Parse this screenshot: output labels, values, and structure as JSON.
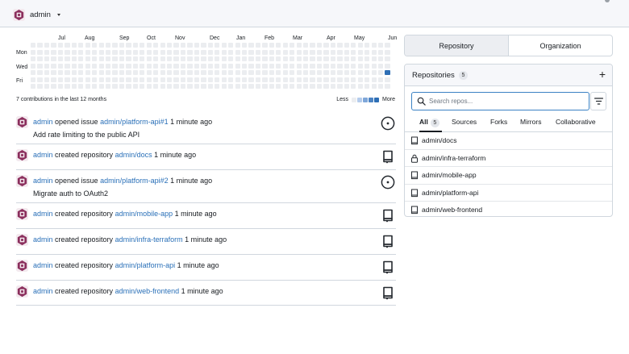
{
  "header": {
    "context_name": "admin"
  },
  "heatmap": {
    "months": [
      "Jul",
      "Aug",
      "Sep",
      "Oct",
      "Nov",
      "Dec",
      "Jan",
      "Feb",
      "Mar",
      "Apr",
      "May",
      "Jun"
    ],
    "day_labels": [
      "Mon",
      "Wed",
      "Fri"
    ],
    "total_text": "7 contributions in the last 12 months",
    "legend_less": "Less",
    "legend_more": "More",
    "level_colors": [
      "#ebedf0",
      "#b4ccec",
      "#7fa7d9",
      "#4c84c4",
      "#2e6fb5"
    ],
    "active_cell": {
      "week_from_end": 0,
      "day": 4,
      "level": 4
    }
  },
  "feed": [
    {
      "user": "admin",
      "action": "opened issue",
      "target": "admin/platform-api#1",
      "time": "1 minute ago",
      "detail": "Add rate limiting to the public API",
      "icon": "issue-opened-icon"
    },
    {
      "user": "admin",
      "action": "created repository",
      "target": "admin/docs",
      "time": "1 minute ago",
      "detail": "",
      "icon": "repo-icon"
    },
    {
      "user": "admin",
      "action": "opened issue",
      "target": "admin/platform-api#2",
      "time": "1 minute ago",
      "detail": "Migrate auth to OAuth2",
      "icon": "issue-opened-icon"
    },
    {
      "user": "admin",
      "action": "created repository",
      "target": "admin/mobile-app",
      "time": "1 minute ago",
      "detail": "",
      "icon": "repo-icon"
    },
    {
      "user": "admin",
      "action": "created repository",
      "target": "admin/infra-terraform",
      "time": "1 minute ago",
      "detail": "",
      "icon": "repo-icon"
    },
    {
      "user": "admin",
      "action": "created repository",
      "target": "admin/platform-api",
      "time": "1 minute ago",
      "detail": "",
      "icon": "repo-icon"
    },
    {
      "user": "admin",
      "action": "created repository",
      "target": "admin/web-frontend",
      "time": "1 minute ago",
      "detail": "",
      "icon": "repo-icon"
    }
  ],
  "right_panel": {
    "tabs": [
      "Repository",
      "Organization"
    ],
    "repos_title": "Repositories",
    "repos_count": "5",
    "search_placeholder": "Search repos...",
    "filters": [
      {
        "label": "All",
        "count": "5",
        "active": true
      },
      {
        "label": "Sources",
        "count": "",
        "active": false
      },
      {
        "label": "Forks",
        "count": "",
        "active": false
      },
      {
        "label": "Mirrors",
        "count": "",
        "active": false
      },
      {
        "label": "Collaborative",
        "count": "",
        "active": false
      }
    ],
    "repos": [
      {
        "name": "admin/docs",
        "icon": "repo-icon"
      },
      {
        "name": "admin/infra-terraform",
        "icon": "lock-icon"
      },
      {
        "name": "admin/mobile-app",
        "icon": "repo-icon"
      },
      {
        "name": "admin/platform-api",
        "icon": "repo-icon"
      },
      {
        "name": "admin/web-frontend",
        "icon": "repo-icon"
      }
    ]
  },
  "colors": {
    "link": "#2a70b8",
    "accent_border": "#3b82c4"
  }
}
